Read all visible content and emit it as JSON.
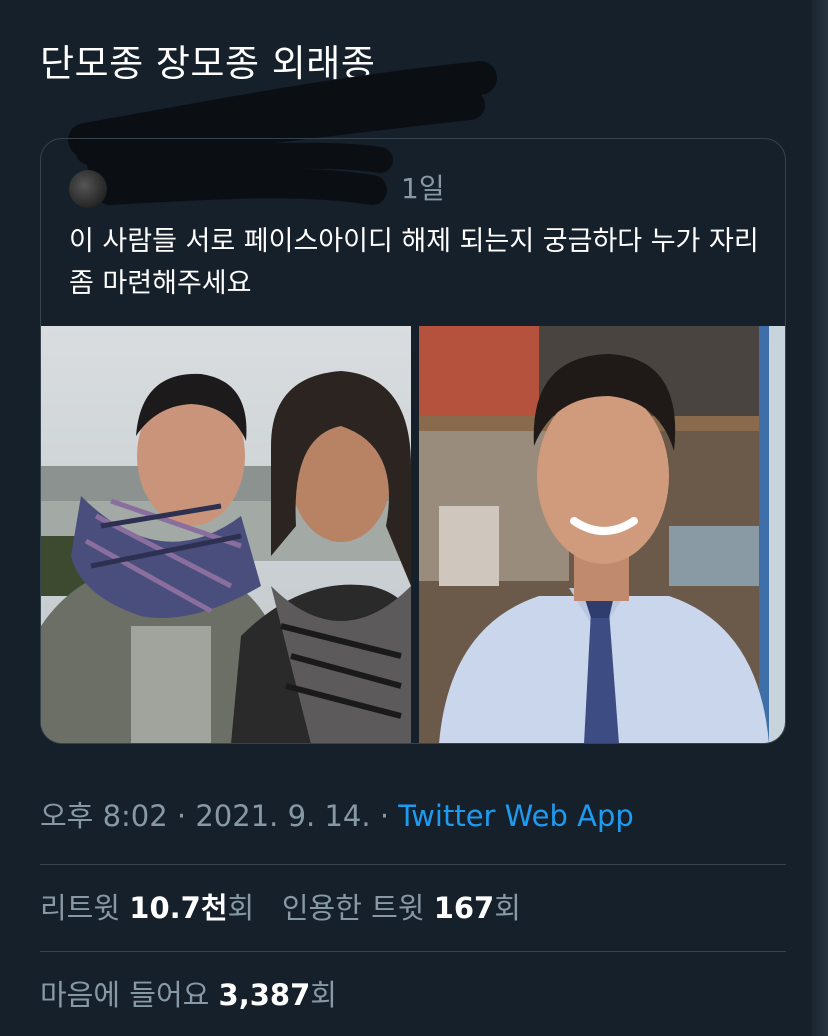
{
  "tweet": {
    "text": "단모종 장모종 외래종"
  },
  "quoted_tweet": {
    "time": "1일",
    "text": "이 사람들 서로 페이스아이디 해제 되는지 궁금하다 누가 자리 좀 마련해주세요",
    "images": [
      "two-men-with-scarves-photo",
      "man-in-blue-shirt-photo"
    ]
  },
  "meta": {
    "time": "오후 8:02",
    "separator1": " · ",
    "date": "2021. 9. 14.",
    "separator2": " · ",
    "source": "Twitter Web App"
  },
  "stats": {
    "retweets_label": "리트윗",
    "retweets_value": "10.7천",
    "retweets_suffix": "회",
    "quotes_label": "인용한 트윗",
    "quotes_value": "167",
    "quotes_suffix": "회",
    "likes_label": "마음에 들어요",
    "likes_value": "3,387",
    "likes_suffix": "회"
  },
  "colors": {
    "background": "#15202b",
    "link": "#1d9bf0",
    "secondary_text": "#8899a6",
    "border": "#38444d"
  }
}
